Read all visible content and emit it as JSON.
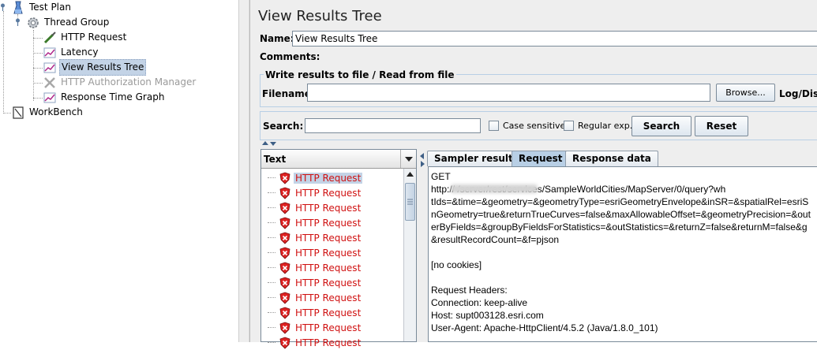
{
  "tree": {
    "test_plan": "Test Plan",
    "thread_group": "Thread Group",
    "http_request": "HTTP Request",
    "latency": "Latency",
    "view_results_tree": "View Results Tree",
    "http_auth_manager": "HTTP Authorization Manager",
    "response_time_graph": "Response Time Graph",
    "workbench": "WorkBench"
  },
  "panel": {
    "title": "View Results Tree",
    "name_label": "Name:",
    "name_value": "View Results Tree",
    "comments_label": "Comments:",
    "write_group_label": "Write results to file / Read from file",
    "filename_label": "Filename",
    "filename_value": "",
    "browse_label": "Browse...",
    "log_display_label": "Log/Disp",
    "search_label": "Search:",
    "search_value": "",
    "case_sensitive_label": "Case sensitive",
    "regular_exp_label": "Regular exp.",
    "search_button": "Search",
    "reset_button": "Reset"
  },
  "results_list": {
    "header": "Text",
    "items": [
      "HTTP Request",
      "HTTP Request",
      "HTTP Request",
      "HTTP Request",
      "HTTP Request",
      "HTTP Request",
      "HTTP Request",
      "HTTP Request",
      "HTTP Request",
      "HTTP Request",
      "HTTP Request",
      "HTTP Request"
    ],
    "selected_index": 0
  },
  "tabs": {
    "sampler_result": "Sampler result",
    "request": "Request",
    "response_data": "Response data",
    "active": "request"
  },
  "request_view": {
    "lines": [
      "GET",
      "http://                        /server/rest/services/SampleWorldCities/MapServer/0/query?wh",
      "tIds=&time=&geometry=&geometryType=esriGeometryEnvelope&inSR=&spatialRel=esriS",
      "nGeometry=true&returnTrueCurves=false&maxAllowableOffset=&geometryPrecision=&out",
      "erByFields=&groupByFieldsForStatistics=&outStatistics=&returnZ=false&returnM=false&g",
      "&resultRecordCount=&f=pjson",
      "",
      "[no cookies]",
      "",
      "Request Headers:",
      "Connection: keep-alive",
      "Host: supt003128.esri.com",
      "User-Agent: Apache-HttpClient/4.5.2 (Java/1.8.0_101)"
    ]
  },
  "colors": {
    "error_text": "#d01010",
    "selection": "#c3d3e6",
    "panel_bg": "#eeeeee",
    "active_tab": "#b8cfe5"
  }
}
